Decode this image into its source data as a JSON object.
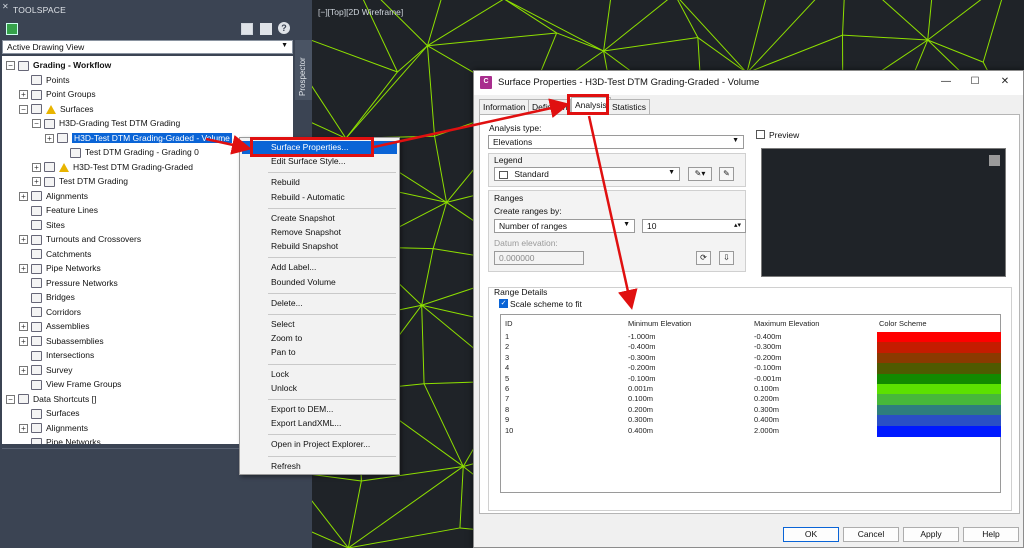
{
  "toolspace": {
    "title": "TOOLSPACE",
    "view_combo": "Active Drawing View",
    "prospector_tab": "Prospector",
    "tree": [
      {
        "label": "Grading - Workflow",
        "indent": 0,
        "bold": true,
        "exp": "−"
      },
      {
        "label": "Points",
        "indent": 1
      },
      {
        "label": "Point Groups",
        "indent": 1,
        "exp": "+"
      },
      {
        "label": "Surfaces",
        "indent": 1,
        "exp": "−",
        "warn": true
      },
      {
        "label": "H3D-Grading Test DTM Grading",
        "indent": 2,
        "exp": "−"
      },
      {
        "label": "H3D-Test DTM Grading-Graded - Volume",
        "indent": 3,
        "exp": "+",
        "selected": true
      },
      {
        "label": "Test DTM Grading - Grading 0",
        "indent": 4
      },
      {
        "label": "H3D-Test DTM Grading-Graded",
        "indent": 2,
        "exp": "+",
        "warn": true
      },
      {
        "label": "Test DTM Grading",
        "indent": 2,
        "exp": "+"
      },
      {
        "label": "Alignments",
        "indent": 1,
        "exp": "+"
      },
      {
        "label": "Feature Lines",
        "indent": 1
      },
      {
        "label": "Sites",
        "indent": 1
      },
      {
        "label": "Turnouts and Crossovers",
        "indent": 1,
        "exp": "+"
      },
      {
        "label": "Catchments",
        "indent": 1
      },
      {
        "label": "Pipe Networks",
        "indent": 1,
        "exp": "+"
      },
      {
        "label": "Pressure Networks",
        "indent": 1
      },
      {
        "label": "Bridges",
        "indent": 1
      },
      {
        "label": "Corridors",
        "indent": 1
      },
      {
        "label": "Assemblies",
        "indent": 1,
        "exp": "+"
      },
      {
        "label": "Subassemblies",
        "indent": 1,
        "exp": "+"
      },
      {
        "label": "Intersections",
        "indent": 1
      },
      {
        "label": "Survey",
        "indent": 1,
        "exp": "+"
      },
      {
        "label": "View Frame Groups",
        "indent": 1
      },
      {
        "label": "Data Shortcuts []",
        "indent": 0,
        "exp": "−"
      },
      {
        "label": "Surfaces",
        "indent": 1
      },
      {
        "label": "Alignments",
        "indent": 1,
        "exp": "+"
      },
      {
        "label": "Pipe Networks",
        "indent": 1
      }
    ]
  },
  "viewport": {
    "label": "[−][Top][2D Wireframe]"
  },
  "context_menu": {
    "items": [
      {
        "label": "Surface Properties...",
        "highlight": true
      },
      {
        "label": "Edit Surface Style..."
      },
      {
        "sep": true
      },
      {
        "label": "Rebuild"
      },
      {
        "label": "Rebuild - Automatic"
      },
      {
        "sep": true
      },
      {
        "label": "Create Snapshot"
      },
      {
        "label": "Remove Snapshot"
      },
      {
        "label": "Rebuild Snapshot"
      },
      {
        "sep": true
      },
      {
        "label": "Add Label..."
      },
      {
        "label": "Bounded Volume"
      },
      {
        "sep": true
      },
      {
        "label": "Delete..."
      },
      {
        "sep": true
      },
      {
        "label": "Select"
      },
      {
        "label": "Zoom to"
      },
      {
        "label": "Pan to"
      },
      {
        "sep": true
      },
      {
        "label": "Lock"
      },
      {
        "label": "Unlock"
      },
      {
        "sep": true
      },
      {
        "label": "Export to DEM..."
      },
      {
        "label": "Export LandXML..."
      },
      {
        "sep": true
      },
      {
        "label": "Open in Project Explorer..."
      },
      {
        "sep": true
      },
      {
        "label": "Refresh"
      }
    ]
  },
  "dialog": {
    "app_icon": "C",
    "title": "Surface Properties - H3D-Test DTM Grading-Graded - Volume",
    "tabs": [
      "Information",
      "Definition",
      "Analysis",
      "Statistics"
    ],
    "active_tab": "Analysis",
    "analysis_type_label": "Analysis type:",
    "analysis_type_value": "Elevations",
    "preview_label": "Preview",
    "legend_label": "Legend",
    "legend_value": "Standard",
    "ranges_label": "Ranges",
    "create_ranges_label": "Create ranges by:",
    "create_ranges_value": "Number of ranges",
    "ranges_count": "10",
    "datum_label": "Datum elevation:",
    "datum_value": "0.000000",
    "range_details_label": "Range Details",
    "scale_scheme_label": "Scale scheme to fit",
    "table_headers": [
      "ID",
      "Minimum Elevation",
      "Maximum Elevation",
      "Color Scheme"
    ],
    "rows": [
      {
        "id": "1",
        "min": "-1.000m",
        "max": "-0.400m",
        "color": "#ff0000"
      },
      {
        "id": "2",
        "min": "-0.400m",
        "max": "-0.300m",
        "color": "#c41c00"
      },
      {
        "id": "3",
        "min": "-0.300m",
        "max": "-0.200m",
        "color": "#8a3a00"
      },
      {
        "id": "4",
        "min": "-0.200m",
        "max": "-0.100m",
        "color": "#4f5a00"
      },
      {
        "id": "5",
        "min": "-0.100m",
        "max": "-0.001m",
        "color": "#128a00"
      },
      {
        "id": "6",
        "min": "0.001m",
        "max": "0.100m",
        "color": "#5ce100"
      },
      {
        "id": "7",
        "min": "0.100m",
        "max": "0.200m",
        "color": "#47b83a"
      },
      {
        "id": "8",
        "min": "0.200m",
        "max": "0.300m",
        "color": "#2e7e7e"
      },
      {
        "id": "9",
        "min": "0.300m",
        "max": "0.400m",
        "color": "#2a4fc6"
      },
      {
        "id": "10",
        "min": "0.400m",
        "max": "2.000m",
        "color": "#0019ff"
      }
    ],
    "buttons": {
      "ok": "OK",
      "cancel": "Cancel",
      "apply": "Apply",
      "help": "Help"
    }
  }
}
